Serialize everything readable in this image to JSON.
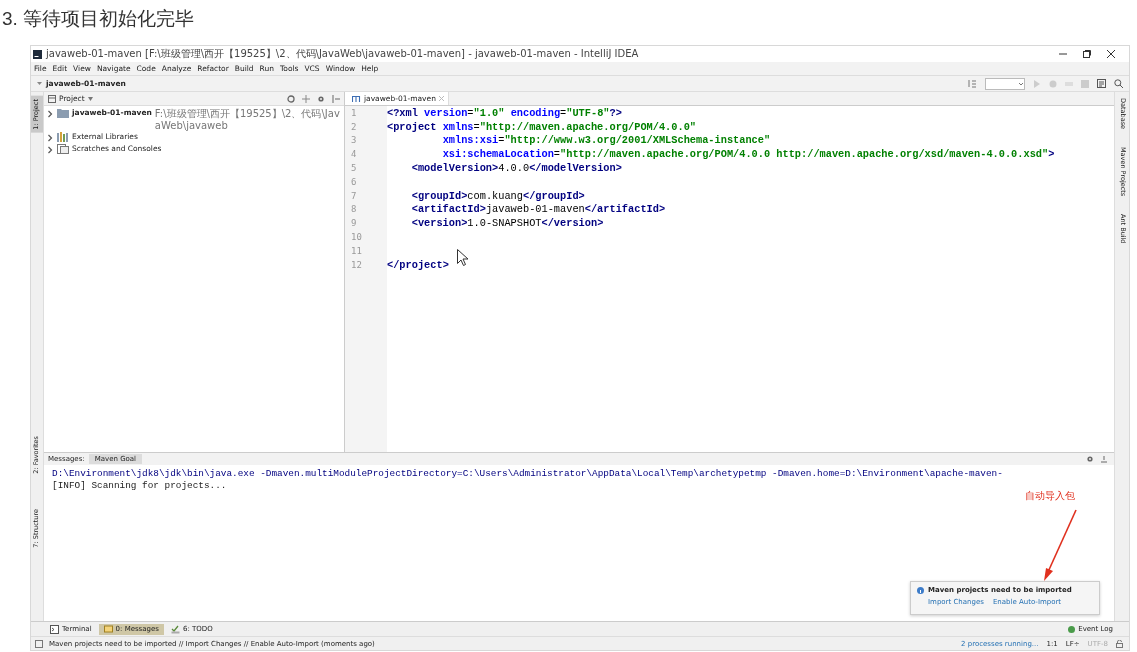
{
  "heading": "3. 等待项目初始化完毕",
  "window": {
    "title": "javaweb-01-maven [F:\\班级管理\\西开【19525】\\2、代码\\JavaWeb\\javaweb-01-maven] - javaweb-01-maven - IntelliJ IDEA"
  },
  "menu": [
    "File",
    "Edit",
    "View",
    "Navigate",
    "Code",
    "Analyze",
    "Refactor",
    "Build",
    "Run",
    "Tools",
    "VCS",
    "Window",
    "Help"
  ],
  "breadcrumb": "javaweb-01-maven",
  "left_strip": [
    {
      "label": "1: Project",
      "selected": true
    },
    {
      "label": "2: Favorites",
      "selected": false
    },
    {
      "label": "7: Structure",
      "selected": false
    }
  ],
  "project_panel": {
    "title": "Project",
    "tree": [
      {
        "name": "javaweb-01-maven",
        "path": "F:\\班级管理\\西开【19525】\\2、代码\\JavaWeb\\javaweb",
        "kind": "module",
        "expanded": false
      },
      {
        "name": "External Libraries",
        "kind": "libraries",
        "expanded": false
      },
      {
        "name": "Scratches and Consoles",
        "kind": "scratches",
        "expanded": false
      }
    ]
  },
  "editor": {
    "tab": "javaweb-01-maven",
    "lines": [
      {
        "number": "1",
        "text": "<?xml version=\"1.0\" encoding=\"UTF-8\"?>"
      },
      {
        "number": "2",
        "text": "<project xmlns=\"http://maven.apache.org/POM/4.0.0\""
      },
      {
        "number": "3",
        "text": "         xmlns:xsi=\"http://www.w3.org/2001/XMLSchema-instance\""
      },
      {
        "number": "4",
        "text": "         xsi:schemaLocation=\"http://maven.apache.org/POM/4.0.0 http://maven.apache.org/xsd/maven-4.0.0.xsd\">"
      },
      {
        "number": "5",
        "text": "    <modelVersion>4.0.0</modelVersion>"
      },
      {
        "number": "6"
      },
      {
        "number": "7",
        "text": "    <groupId>com.kuang</groupId>"
      },
      {
        "number": "8",
        "text": "    <artifactId>javaweb-01-maven</artifactId>"
      },
      {
        "number": "9",
        "text": "    <version>1.0-SNAPSHOT</version>"
      },
      {
        "number": "10"
      },
      {
        "number": "11"
      },
      {
        "number": "12",
        "text": "</project>"
      }
    ]
  },
  "right_strip": [
    {
      "label": "Database"
    },
    {
      "label": "Maven Projects"
    },
    {
      "label": "Ant Build"
    }
  ],
  "messages": {
    "label": "Messages:",
    "tabs": [
      {
        "label": "Maven Goal",
        "selected": true
      }
    ],
    "output": [
      "D:\\Environment\\jdk8\\jdk\\bin\\java.exe -Dmaven.multiModuleProjectDirectory=C:\\Users\\Administrator\\AppData\\Local\\Temp\\archetypetmp -Dmaven.home=D:\\Environment\\apache-maven-",
      "[INFO] Scanning for projects..."
    ]
  },
  "notification": {
    "title": "Maven projects need to be imported",
    "links": [
      "Import Changes",
      "Enable Auto-Import"
    ]
  },
  "annotation": "自动导入包",
  "tool_buttons": [
    {
      "label": "Terminal",
      "selected": false,
      "kind": "terminal"
    },
    {
      "label": "0: Messages",
      "selected": true,
      "kind": "messages"
    },
    {
      "label": "6: TODO",
      "selected": false,
      "kind": "todo"
    }
  ],
  "event_log": "Event Log",
  "status_bar": {
    "message": "Maven projects need to be imported // Import Changes // Enable Auto-Import (moments ago)",
    "processes": "2 processes running...",
    "position": "1:1",
    "line_separator": "LF÷",
    "encoding": "UTF-8"
  }
}
